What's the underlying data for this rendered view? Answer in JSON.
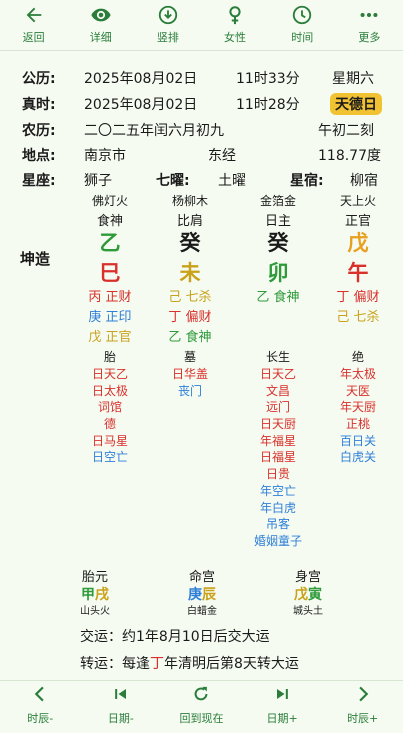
{
  "colors": {
    "accent": "#2a7d3a",
    "green": "#2e9a3a",
    "red": "#d9302c",
    "gold": "#c9a21a",
    "blue": "#2f7fd8",
    "badge": "#f1c232",
    "background": "#f5fbf1"
  },
  "toolbar": [
    {
      "icon": "arrow-left-icon",
      "label": "返回"
    },
    {
      "icon": "eye-icon",
      "label": "详细"
    },
    {
      "icon": "arrow-down-circle-icon",
      "label": "竖排"
    },
    {
      "icon": "female-icon",
      "label": "女性"
    },
    {
      "icon": "clock-icon",
      "label": "时间"
    },
    {
      "icon": "more-dots-icon",
      "label": "更多"
    }
  ],
  "info": {
    "gongli": {
      "key": "公历:",
      "date": "2025年08月02日",
      "time": "11时33分",
      "week": "星期六"
    },
    "zhenshi": {
      "key": "真时:",
      "date": "2025年08月02日",
      "time": "11时28分",
      "badge": "天德日"
    },
    "nongli": {
      "key": "农历:",
      "date": "二〇二五年闰六月初九",
      "ke": "午初二刻"
    },
    "didian": {
      "key": "地点:",
      "city": "南京市",
      "lng_label": "东经",
      "lng_value": "118.77度"
    },
    "xingzuo": {
      "key": "星座:",
      "value": "狮子",
      "qiyao_key": "七曜:",
      "qiyao_value": "土曜",
      "xingxiu_key": "星宿:",
      "xingxiu_value": "柳宿"
    }
  },
  "kunzao": "坤造",
  "pillars": [
    {
      "star": "佛灯火",
      "shen": "食神",
      "gan": "乙",
      "gan_color": "green",
      "zhi": "巳",
      "zhi_color": "red",
      "cang": [
        {
          "text": "丙 正财",
          "color": "red"
        },
        {
          "text": "庚 正印",
          "color": "blue"
        },
        {
          "text": "戊 正官",
          "color": "gold"
        }
      ],
      "stage": "胎",
      "shensha": [
        {
          "text": "日天乙",
          "color": "red"
        },
        {
          "text": "日太极",
          "color": "red"
        },
        {
          "text": "词馆",
          "color": "red"
        },
        {
          "text": "德",
          "color": "red"
        },
        {
          "text": "日马星",
          "color": "red"
        },
        {
          "text": "日空亡",
          "color": "blue"
        }
      ]
    },
    {
      "star": "杨柳木",
      "shen": "比肩",
      "gan": "癸",
      "gan_color": "black",
      "zhi": "未",
      "zhi_color": "gold",
      "cang": [
        {
          "text": "己 七杀",
          "color": "gold"
        },
        {
          "text": "丁 偏财",
          "color": "red"
        },
        {
          "text": "乙 食神",
          "color": "green"
        }
      ],
      "stage": "墓",
      "shensha": [
        {
          "text": "日华盖",
          "color": "red"
        },
        {
          "text": "丧门",
          "color": "blue"
        }
      ]
    },
    {
      "star": "金箔金",
      "shen": "日主",
      "gan": "癸",
      "gan_color": "black",
      "zhi": "卯",
      "zhi_color": "green",
      "cang": [
        {
          "text": "乙 食神",
          "color": "green"
        }
      ],
      "stage": "长生",
      "shensha": [
        {
          "text": "日天乙",
          "color": "red"
        },
        {
          "text": "文昌",
          "color": "red"
        },
        {
          "text": "远门",
          "color": "red"
        },
        {
          "text": "日天厨",
          "color": "red"
        },
        {
          "text": "年福星",
          "color": "red"
        },
        {
          "text": "日福星",
          "color": "red"
        },
        {
          "text": "日贵",
          "color": "red"
        },
        {
          "text": "年空亡",
          "color": "blue"
        },
        {
          "text": "年白虎",
          "color": "blue"
        },
        {
          "text": "吊客",
          "color": "blue"
        },
        {
          "text": "婚姻童子",
          "color": "blue"
        }
      ]
    },
    {
      "star": "天上火",
      "shen": "正官",
      "gan": "戊",
      "gan_color": "fire",
      "zhi": "午",
      "zhi_color": "red",
      "cang": [
        {
          "text": "丁 偏财",
          "color": "red"
        },
        {
          "text": "己 七杀",
          "color": "gold"
        }
      ],
      "stage": "绝",
      "shensha": [
        {
          "text": "年太极",
          "color": "red"
        },
        {
          "text": "天医",
          "color": "red"
        },
        {
          "text": "年天厨",
          "color": "red"
        },
        {
          "text": "正桃",
          "color": "red"
        },
        {
          "text": "百日关",
          "color": "blue"
        },
        {
          "text": "白虎关",
          "color": "blue"
        }
      ]
    }
  ],
  "extra": [
    {
      "title": "胎元",
      "gan": "甲",
      "gan_color": "green",
      "zhi": "戌",
      "zhi_color": "gold",
      "nayin": "山头火"
    },
    {
      "title": "命宫",
      "gan": "庚",
      "gan_color": "blue",
      "zhi": "辰",
      "zhi_color": "gold",
      "nayin": "白蜡金"
    },
    {
      "title": "身宫",
      "gan": "戊",
      "gan_color": "gold",
      "zhi": "寅",
      "zhi_color": "green",
      "nayin": "城头土"
    }
  ],
  "jiaoyun": "交运：约1年8月10日后交大运",
  "zhuanyun": {
    "prefix": "转运：每逢",
    "gan": "丁",
    "suffix": "年清明后第8天转大运"
  },
  "bottom_nav": [
    {
      "icon": "chevron-left-icon",
      "label": "时辰-"
    },
    {
      "icon": "skip-previous-icon",
      "label": "日期-"
    },
    {
      "icon": "refresh-icon",
      "label": "回到现在"
    },
    {
      "icon": "skip-next-icon",
      "label": "日期+"
    },
    {
      "icon": "chevron-right-icon",
      "label": "时辰+"
    }
  ]
}
